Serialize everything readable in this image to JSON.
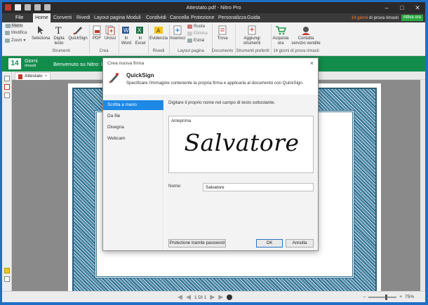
{
  "window": {
    "title": "Attestato.pdf - Nitro Pro"
  },
  "ribbon_tabs": {
    "file": "File",
    "tabs": [
      "Home",
      "Converti",
      "Rivedi",
      "Layout pagina",
      "Moduli",
      "Condividi",
      "Cancella",
      "Protezione",
      "Personalizza",
      "Guida"
    ],
    "trial_prefix": "14 giorni",
    "trial_suffix": " di prova rimasti",
    "activate": "Attiva ora"
  },
  "ribbon": {
    "tools": {
      "mano": "Mano",
      "modifica": "Modifica",
      "zoom": "Zoom"
    },
    "seleziona": "Seleziona",
    "digita_testo": [
      "Digita",
      "testo"
    ],
    "quicksign": "QuickSign",
    "pdf": "PDF",
    "unisci": "Unisci",
    "in_word": [
      "In",
      "Word"
    ],
    "in_excel": [
      "In",
      "Excel"
    ],
    "evidenzia": "Evidenzia",
    "inserisci": "Inserisci",
    "ruota": "Ruota",
    "elimina": "Elimina",
    "estrai": "Estrai",
    "trova": "Trova",
    "aggiungi": [
      "Aggiungi",
      "strumenti"
    ],
    "acquista": [
      "Acquista",
      "ora"
    ],
    "contatta": [
      "Contatta",
      "servizio vendite"
    ],
    "groups": [
      "Strumenti",
      "Crea",
      "Rivedi",
      "Layout pagina",
      "Documento",
      "Strumenti preferiti",
      "14 giorni di prova rimasti"
    ]
  },
  "banner": {
    "days": "14",
    "days_label": "Giorni",
    "days_sub": "rimasti",
    "welcome": "Benvenuto su Nitro: lav"
  },
  "doc_tab": {
    "name": "Attestato",
    "close": "×"
  },
  "status": {
    "page": "1 DI 1",
    "zoom": "75%"
  },
  "dialog": {
    "title": "Crea nuova firma",
    "close": "×",
    "heading": "QuickSign",
    "description": "Specificare l'immagine contenente la propria firma e applicarla al documento con QuickSign.",
    "nav": [
      "Scritta a mano",
      "Da file",
      "Disegna",
      "Webcam"
    ],
    "hint": "Digitare il proprio nome nel campo di testo sottostante.",
    "preview_label": "Anteprima",
    "signature": "Salvatore",
    "name_label": "Nome:",
    "name_value": "Salvatore",
    "btn_password": "Protezione tramite password",
    "btn_ok": "OK",
    "btn_cancel": "Annulla"
  }
}
